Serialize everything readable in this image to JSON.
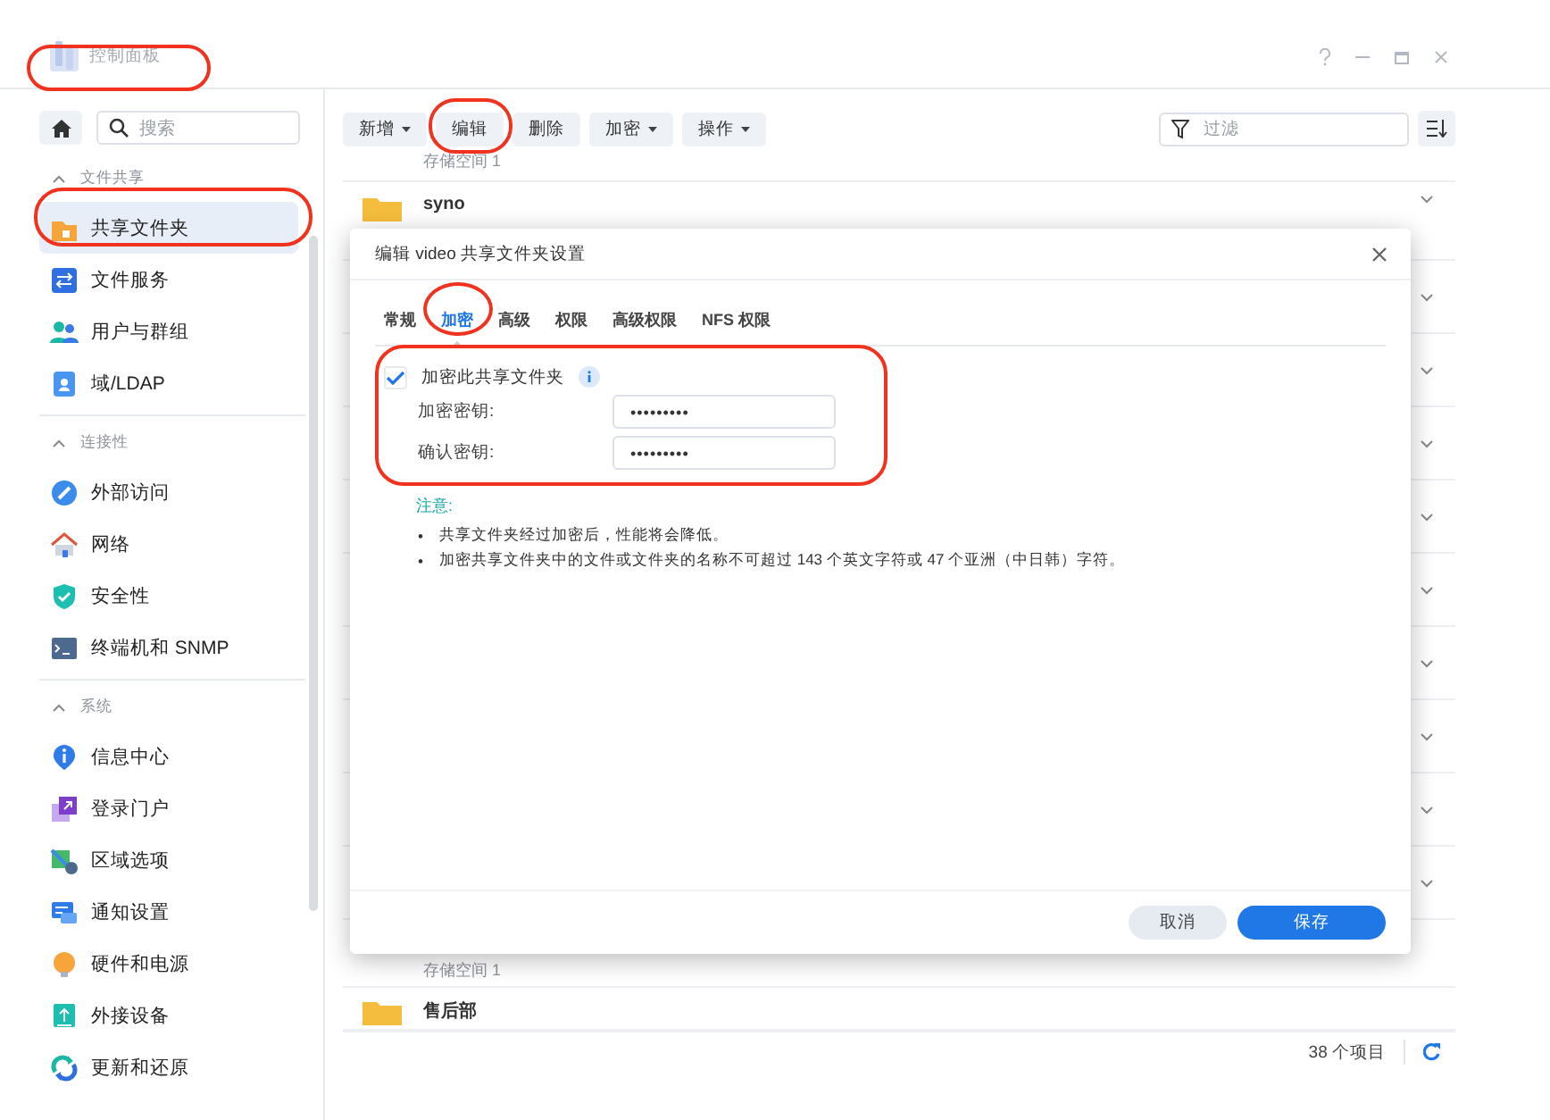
{
  "window": {
    "title": "控制面板"
  },
  "sidebar": {
    "search": {
      "placeholder": "搜索"
    },
    "sections": [
      {
        "header": "文件共享",
        "expanded": true,
        "items": [
          {
            "label": "共享文件夹",
            "selected": true
          },
          {
            "label": "文件服务",
            "selected": false
          },
          {
            "label": "用户与群组",
            "selected": false
          },
          {
            "label": "域/LDAP",
            "selected": false
          }
        ]
      },
      {
        "header": "连接性",
        "expanded": true,
        "items": [
          {
            "label": "外部访问",
            "selected": false
          },
          {
            "label": "网络",
            "selected": false
          },
          {
            "label": "安全性",
            "selected": false
          },
          {
            "label": "终端机和 SNMP",
            "selected": false
          }
        ]
      },
      {
        "header": "系统",
        "expanded": true,
        "items": [
          {
            "label": "信息中心",
            "selected": false
          },
          {
            "label": "登录门户",
            "selected": false
          },
          {
            "label": "区域选项",
            "selected": false
          },
          {
            "label": "通知设置",
            "selected": false
          },
          {
            "label": "硬件和电源",
            "selected": false
          },
          {
            "label": "外接设备",
            "selected": false
          },
          {
            "label": "更新和还原",
            "selected": false
          }
        ]
      }
    ]
  },
  "toolbar": {
    "buttons": [
      {
        "label": "新增",
        "dropdown": true
      },
      {
        "label": "编辑",
        "dropdown": false
      },
      {
        "label": "删除",
        "dropdown": false
      },
      {
        "label": "加密",
        "dropdown": true
      },
      {
        "label": "操作",
        "dropdown": true
      }
    ],
    "filter": {
      "placeholder": "过滤"
    }
  },
  "list": {
    "top_rows": [
      {
        "subtitle": "存储空间 1"
      },
      {
        "title": "syno"
      }
    ],
    "bottom_rows": [
      {
        "subtitle": "存储空间 1"
      },
      {
        "title": "售后部"
      }
    ]
  },
  "status_bar": {
    "count": "38 个项目"
  },
  "dialog": {
    "title": "编辑 video 共享文件夹设置",
    "tabs": [
      {
        "label": "常规",
        "selected": false
      },
      {
        "label": "加密",
        "selected": true
      },
      {
        "label": "高级",
        "selected": false
      },
      {
        "label": "权限",
        "selected": false
      },
      {
        "label": "高级权限",
        "selected": false
      },
      {
        "label": "NFS 权限",
        "selected": false
      }
    ],
    "checkbox": {
      "label": "加密此共享文件夹",
      "checked": true
    },
    "fields": [
      {
        "label": "加密密钥:",
        "value": "•••••••••"
      },
      {
        "label": "确认密钥:",
        "value": "•••••••••"
      }
    ],
    "note": {
      "heading": "注意:",
      "marker": "•",
      "bullets": [
        "共享文件夹经过加密后，性能将会降低。",
        "加密共享文件夹中的文件或文件夹的名称不可超过 143 个英文字符或 47 个亚洲（中日韩）字符。"
      ]
    },
    "buttons": [
      {
        "label": "取消",
        "kind": "secondary"
      },
      {
        "label": "保存",
        "kind": "primary"
      }
    ]
  }
}
